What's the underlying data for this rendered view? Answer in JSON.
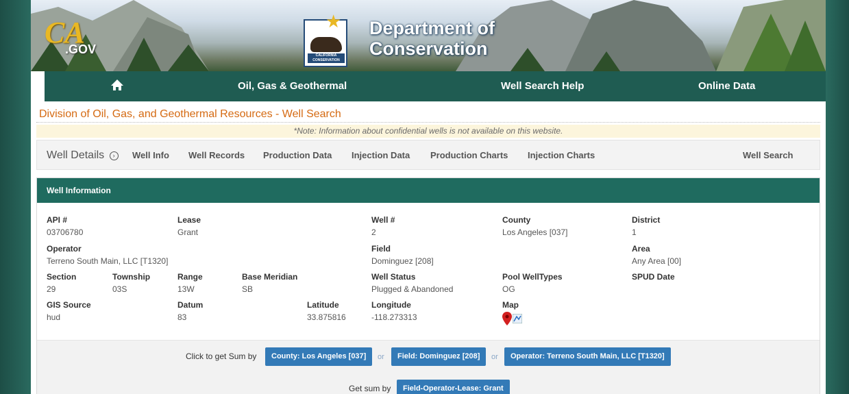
{
  "banner": {
    "ca_logo": "CA",
    "gov_label": ".GOV",
    "seal_label": "CALIFORNIA CONSERVATION",
    "title_line1": "Department of",
    "title_line2": "Conservation"
  },
  "nav": {
    "home_icon": "home-icon",
    "items": [
      "Oil, Gas & Geothermal",
      "Well Search Help",
      "Online Data"
    ]
  },
  "page": {
    "title": "Division of Oil, Gas, and Geothermal Resources - Well Search",
    "note": "*Note: Information about confidential wells is not available on this website."
  },
  "tabs": {
    "title": "Well Details",
    "items": [
      "Well Info",
      "Well Records",
      "Production Data",
      "Injection Data",
      "Production Charts",
      "Injection Charts"
    ],
    "right": "Well Search"
  },
  "well": {
    "header": "Well Information",
    "api_label": "API #",
    "api": "03706780",
    "lease_label": "Lease",
    "lease": "Grant",
    "wellno_label": "Well #",
    "wellno": "2",
    "county_label": "County",
    "county": "Los Angeles [037]",
    "district_label": "District",
    "district": "1",
    "operator_label": "Operator",
    "operator": "Terreno South Main, LLC [T1320]",
    "field_label": "Field",
    "field": "Dominguez [208]",
    "area_label": "Area",
    "area": "Any Area [00]",
    "section_label": "Section",
    "section": "29",
    "township_label": "Township",
    "township": "03S",
    "range_label": "Range",
    "range": "13W",
    "base_label": "Base Meridian",
    "base": "SB",
    "status_label": "Well Status",
    "status": "Plugged & Abandoned",
    "pool_label": "Pool WellTypes",
    "pool": "OG",
    "spud_label": "SPUD Date",
    "gis_label": "GIS Source",
    "gis": "hud",
    "datum_label": "Datum",
    "datum": "83",
    "lat_label": "Latitude",
    "lat": "33.875816",
    "lon_label": "Longitude",
    "lon": "-118.273313",
    "map_label": "Map"
  },
  "sum": {
    "click_label": "Click to get Sum by",
    "county_btn": "County: Los Angeles [037]",
    "or": "or",
    "field_btn": "Field: Dominguez [208]",
    "operator_btn": "Operator: Terreno South Main, LLC [T1320]",
    "get_label": "Get sum by",
    "fol_btn": "Field-Operator-Lease: Grant"
  },
  "colors": {
    "nav_bg": "#1f5c52",
    "title": "#d56a12",
    "button": "#337ab7",
    "note_bg": "#fcf5dc"
  }
}
